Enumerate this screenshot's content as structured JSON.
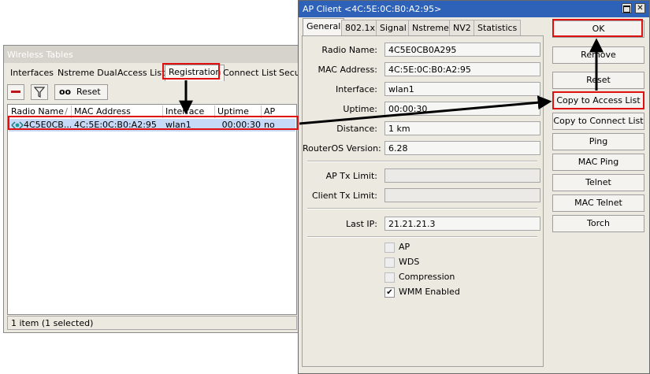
{
  "wireless_tables": {
    "title": "Wireless Tables",
    "tabs": [
      "Interfaces",
      "Nstreme Dual",
      "Access List",
      "Registration",
      "Connect List",
      "Secu"
    ],
    "active_tab": "Registration",
    "toolbar": {
      "reset_label": "Reset",
      "reset_icon_text": "oo"
    },
    "columns": [
      "Radio Name",
      "MAC Address",
      "Interface",
      "Uptime",
      "AP"
    ],
    "rows": [
      {
        "radio_name": "4C5E0CB...",
        "mac": "4C:5E:0C:B0:A2:95",
        "interface": "wlan1",
        "uptime": "00:00:30",
        "ap": "no"
      }
    ],
    "status": "1 item (1 selected)"
  },
  "ap_client": {
    "title": "AP Client <4C:5E:0C:B0:A2:95>",
    "tabs": [
      "General",
      "802.1x",
      "Signal",
      "Nstreme",
      "NV2",
      "Statistics"
    ],
    "active_tab": "General",
    "fields": {
      "radio_name": {
        "label": "Radio Name:",
        "value": "4C5E0CB0A295"
      },
      "mac_address": {
        "label": "MAC Address:",
        "value": "4C:5E:0C:B0:A2:95"
      },
      "interface": {
        "label": "Interface:",
        "value": "wlan1"
      },
      "uptime": {
        "label": "Uptime:",
        "value": "00:00:30"
      },
      "distance": {
        "label": "Distance:",
        "value": "1 km"
      },
      "routeros_version": {
        "label": "RouterOS Version:",
        "value": "6.28"
      },
      "ap_tx_limit": {
        "label": "AP Tx Limit:",
        "value": ""
      },
      "client_tx_limit": {
        "label": "Client Tx Limit:",
        "value": ""
      },
      "last_ip": {
        "label": "Last IP:",
        "value": "21.21.21.3"
      }
    },
    "checkboxes": [
      {
        "label": "AP",
        "checked": false
      },
      {
        "label": "WDS",
        "checked": false
      },
      {
        "label": "Compression",
        "checked": false
      },
      {
        "label": "WMM Enabled",
        "checked": true
      }
    ],
    "buttons": {
      "ok": "OK",
      "remove": "Remove",
      "reset": "Reset",
      "copy_to_access_list": "Copy to Access List",
      "copy_to_connect_list": "Copy to Connect List",
      "ping": "Ping",
      "mac_ping": "MAC Ping",
      "telnet": "Telnet",
      "mac_telnet": "MAC Telnet",
      "torch": "Torch"
    }
  },
  "colors": {
    "highlight": "#e01010",
    "selection": "#c6d9f7",
    "titlebar_active": "#2d62b8"
  }
}
